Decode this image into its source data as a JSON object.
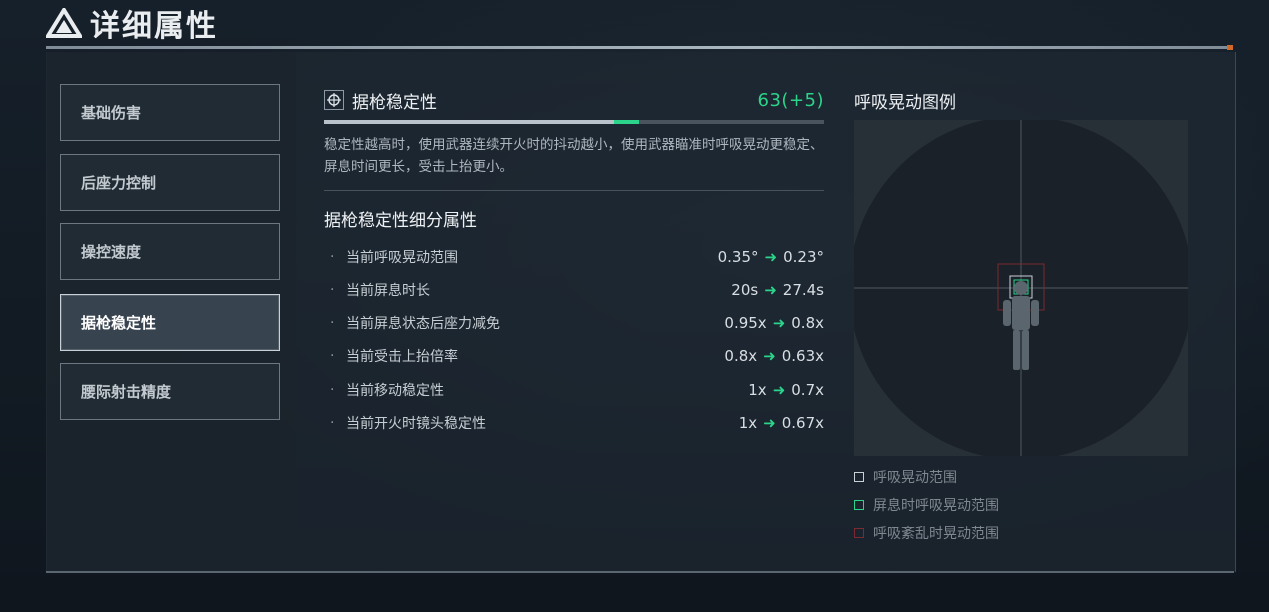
{
  "header": {
    "title": "详细属性"
  },
  "nav": {
    "items": [
      {
        "label": "基础伤害",
        "active": false
      },
      {
        "label": "后座力控制",
        "active": false
      },
      {
        "label": "操控速度",
        "active": false
      },
      {
        "label": "据枪稳定性",
        "active": true
      },
      {
        "label": "腰际射击精度",
        "active": false
      }
    ]
  },
  "stat": {
    "icon": "crosshair-icon",
    "name": "据枪稳定性",
    "value": "63(+5)",
    "base_fraction": 0.58,
    "bonus_fraction": 0.05,
    "description": "稳定性越高时，使用武器连续开火时的抖动越小，使用武器瞄准时呼吸晃动更稳定、屏息时间更长，受击上抬更小。"
  },
  "breakdown": {
    "title": "据枪稳定性细分属性",
    "rows": [
      {
        "label": "当前呼吸晃动范围",
        "from": "0.35°",
        "to": "0.23°"
      },
      {
        "label": "当前屏息时长",
        "from": "20s",
        "to": "27.4s"
      },
      {
        "label": "当前屏息状态后座力减免",
        "from": "0.95x",
        "to": "0.8x"
      },
      {
        "label": "当前受击上抬倍率",
        "from": "0.8x",
        "to": "0.63x"
      },
      {
        "label": "当前移动稳定性",
        "from": "1x",
        "to": "0.7x"
      },
      {
        "label": "当前开火时镜头稳定性",
        "from": "1x",
        "to": "0.67x"
      }
    ]
  },
  "legend": {
    "title": "呼吸晃动图例",
    "keys": [
      {
        "label": "呼吸晃动范围",
        "color": "#c9d0d6"
      },
      {
        "label": "屏息时呼吸晃动范围",
        "color": "#2bd48a"
      },
      {
        "label": "呼吸紊乱时晃动范围",
        "color": "#7a2a30"
      }
    ]
  },
  "colors": {
    "accent_green": "#2bd48a",
    "arrow": "#2bd48a"
  }
}
